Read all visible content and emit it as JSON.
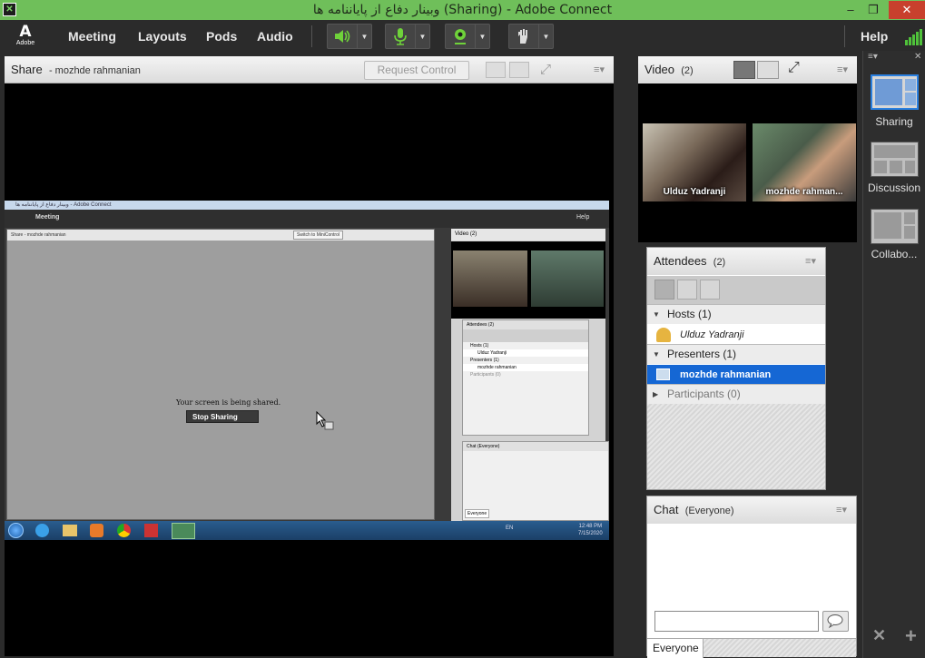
{
  "window": {
    "title": "وبینار دفاع از پایاننامه ها (Sharing) - Adobe Connect",
    "minimize": "–",
    "restore": "❐",
    "close": "✕"
  },
  "menubar": {
    "logo_letter": "A",
    "logo_text": "Adobe",
    "items": [
      "Meeting",
      "Layouts",
      "Pods",
      "Audio"
    ],
    "help": "Help",
    "icons": [
      "speaker-icon",
      "microphone-icon",
      "webcam-icon",
      "raise-hand-icon"
    ]
  },
  "share_pod": {
    "title": "Share",
    "presenter": "- mozhde rahmanian",
    "request_control": "Request Control",
    "menu_icon": "≡▾",
    "inner_screen": {
      "window_title": "وبینار دفاع از پایاننامه ها - Adobe Connect",
      "menu_item": "Meeting",
      "help": "Help",
      "share_title": "Share",
      "share_presenter": "- mozhde rahmanian",
      "switch_btn": "Switch to MiniControl",
      "message": "Your screen is being shared.",
      "stop_button": "Stop Sharing",
      "video_title": "Video",
      "video_count": "(2)",
      "attendees_title": "Attendees",
      "attendees_count": "(2)",
      "hosts": "Hosts (1)",
      "host_name": "Ulduz Yadranji",
      "presenters": "Presenters (1)",
      "presenter_name": "mozhde rahmanian",
      "participants": "Participants (0)",
      "chat_title": "Chat",
      "chat_scope": "(Everyone)",
      "chat_everyone": "Everyone",
      "tray_lang": "EN",
      "clock_time": "12:48 PM",
      "clock_date": "7/15/2020"
    }
  },
  "video_pod": {
    "title": "Video",
    "count": "(2)",
    "feeds": [
      {
        "name": "Ulduz Yadranji"
      },
      {
        "name": "mozhde rahman..."
      }
    ]
  },
  "attendees_pod": {
    "title": "Attendees",
    "count": "(2)",
    "groups": {
      "hosts": "Hosts (1)",
      "host_name": "Ulduz Yadranji",
      "presenters": "Presenters (1)",
      "presenter_name": "mozhde rahmanian",
      "participants": "Participants (0)"
    }
  },
  "chat_pod": {
    "title": "Chat",
    "scope": "(Everyone)",
    "input_value": "",
    "everyone_tab": "Everyone"
  },
  "layouts_panel": {
    "items": [
      {
        "label": "Sharing",
        "selected": true
      },
      {
        "label": "Discussion",
        "selected": false
      },
      {
        "label": "Collabo...",
        "selected": false
      }
    ]
  },
  "colors": {
    "titlebar": "#6fbf5a",
    "selected_row": "#1567d4",
    "layout_selected": "#2a80e0",
    "active_icon_green": "#6fd23a"
  }
}
